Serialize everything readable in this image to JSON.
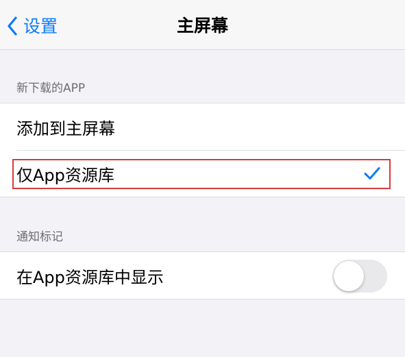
{
  "nav": {
    "back_label": "设置",
    "title": "主屏幕"
  },
  "sections": [
    {
      "header": "新下载的APP",
      "rows": [
        {
          "label": "添加到主屏幕",
          "selected": false
        },
        {
          "label": "仅App资源库",
          "selected": true,
          "highlighted": true
        }
      ]
    },
    {
      "header": "通知标记",
      "rows": [
        {
          "label": "在App资源库中显示",
          "toggle_on": false
        }
      ]
    }
  ],
  "icons": {
    "back": "chevron-left-icon",
    "check": "checkmark-icon"
  },
  "colors": {
    "accent": "#0a7aff",
    "highlight_border": "#d63a3a",
    "background": "#f2f2f7",
    "toggle_off": "#e9e9eb"
  }
}
